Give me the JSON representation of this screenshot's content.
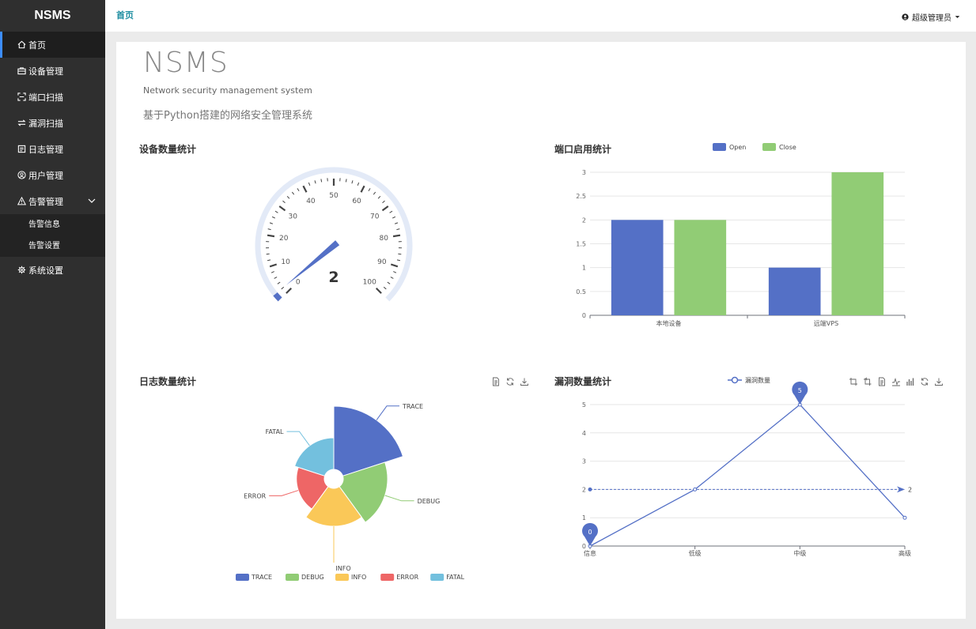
{
  "brand": "NSMS",
  "sidebar": {
    "items": [
      {
        "label": "首页",
        "icon": "home-icon"
      },
      {
        "label": "设备管理",
        "icon": "briefcase-icon"
      },
      {
        "label": "端口扫描",
        "icon": "scan-icon"
      },
      {
        "label": "漏洞扫描",
        "icon": "swap-icon"
      },
      {
        "label": "日志管理",
        "icon": "log-icon"
      },
      {
        "label": "用户管理",
        "icon": "user-icon"
      },
      {
        "label": "告警管理",
        "icon": "warning-icon"
      }
    ],
    "alarm_sub": [
      "告警信息",
      "告警设置"
    ],
    "settings": {
      "label": "系统设置",
      "icon": "gear-icon"
    }
  },
  "header": {
    "breadcrumb": "首页",
    "user": "超级管理员"
  },
  "hero": {
    "title": "NSMS",
    "subtitle": "Network security management system",
    "description": "基于Python搭建的网络安全管理系统"
  },
  "cards": {
    "device": "设备数量统计",
    "port": "端口启用统计",
    "log": "日志数量统计",
    "vuln": "漏洞数量统计"
  },
  "chart_data": [
    {
      "type": "gauge",
      "title": "设备数量统计",
      "value": 2,
      "min": 0,
      "max": 100,
      "ticks": [
        0,
        10,
        20,
        30,
        40,
        50,
        60,
        70,
        80,
        90,
        100
      ],
      "color": "#5470c6"
    },
    {
      "type": "bar",
      "title": "端口启用统计",
      "categories": [
        "本地设备",
        "远端VPS"
      ],
      "series": [
        {
          "name": "Open",
          "values": [
            2,
            1
          ],
          "color": "#5470c6"
        },
        {
          "name": "Close",
          "values": [
            2,
            3
          ],
          "color": "#91cc75"
        }
      ],
      "ylim": [
        0,
        3
      ],
      "yticks": [
        "0",
        "0.5",
        "1",
        "1.5",
        "2",
        "2.5",
        "3"
      ],
      "legend": "top"
    },
    {
      "type": "pie",
      "subtype": "rose",
      "title": "日志数量统计",
      "slices": [
        {
          "name": "TRACE",
          "value": 5,
          "color": "#5470c6"
        },
        {
          "name": "DEBUG",
          "value": 3.5,
          "color": "#91cc75"
        },
        {
          "name": "INFO",
          "value": 3,
          "color": "#fac858"
        },
        {
          "name": "ERROR",
          "value": 2.2,
          "color": "#ee6666"
        },
        {
          "name": "FATAL",
          "value": 2.5,
          "color": "#73c0de"
        }
      ],
      "legend": "bottom"
    },
    {
      "type": "line",
      "title": "漏洞数量统计",
      "series_name": "漏洞数量",
      "categories": [
        "信息",
        "低级",
        "中级",
        "高级"
      ],
      "values": [
        0,
        2,
        5,
        1
      ],
      "ylim": [
        0,
        5
      ],
      "yticks": [
        "0",
        "1",
        "2",
        "3",
        "4",
        "5"
      ],
      "max_label": "5",
      "min_label": "0",
      "average": 2,
      "average_label": "2",
      "color": "#5470c6",
      "legend": "top"
    }
  ]
}
